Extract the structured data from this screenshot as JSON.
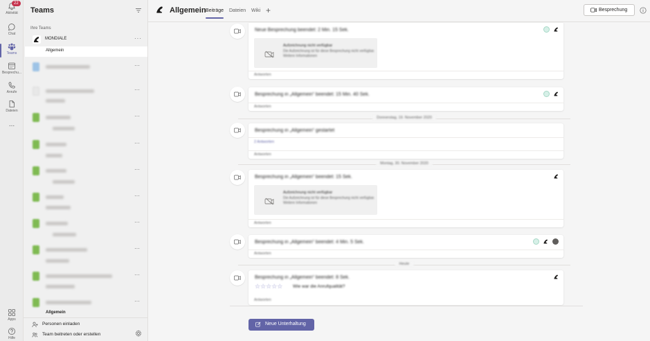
{
  "rail": {
    "activity": {
      "label": "Aktivität",
      "badge": "22"
    },
    "chat": {
      "label": "Chat"
    },
    "teams": {
      "label": "Teams"
    },
    "calendar": {
      "label": "Besprechu..."
    },
    "calls": {
      "label": "Anrufe"
    },
    "files": {
      "label": "Dateien"
    },
    "more": {
      "label": "..."
    },
    "apps": {
      "label": "Apps"
    },
    "help": {
      "label": "Hilfe"
    }
  },
  "panel": {
    "title": "Teams",
    "section_label": "Ihre Teams",
    "team_name": "MONDIALE",
    "channel_name": "Allgemein",
    "more": "···",
    "last_channel": "Allgemein",
    "invite": "Personen einladen",
    "join": "Team beitreten oder erstellen"
  },
  "header": {
    "channel_title": "Allgemein",
    "tabs": [
      "Beiträge",
      "Dateien",
      "Wiki"
    ],
    "add_tab": "+",
    "meet_button": "Besprechung"
  },
  "feed": {
    "posts": [
      {
        "title": "Neue Besprechung beendet: 2 Min. 15 Sek.",
        "reply": "Antworten",
        "card": {
          "l1": "Aufzeichnung nicht verfügbar",
          "l2": "Die Aufzeichnung ist für diese Besprechung nicht verfügbar.",
          "l3": "Weitere Informationen"
        }
      },
      {
        "title": "Besprechung in „Allgemein“ beendet: 15 Min. 40 Sek.",
        "reply": "Antworten"
      },
      {
        "title": "Besprechung in „Allgemein“ gestartet",
        "link": "2 Antworten",
        "reply": "Antworten"
      },
      {
        "title": "Besprechung in „Allgemein“ beendet: 15 Sek.",
        "reply": "Antworten",
        "card": {
          "l1": "Aufzeichnung nicht verfügbar",
          "l2": "Die Aufzeichnung ist für diese Besprechung nicht verfügbar.",
          "l3": "Weitere Informationen"
        }
      },
      {
        "title": "Besprechung in „Allgemein“ beendet: 4 Min. 5 Sek.",
        "reply": "Antworten"
      },
      {
        "title": "Besprechung in „Allgemein“ beendet: 8 Sek.",
        "rating_text": "Wie war die Anrufqualität?",
        "reply": "Antworten"
      }
    ],
    "separators": [
      "Donnerstag, 19. November 2020",
      "Montag, 30. November 2020",
      "Heute"
    ],
    "new_conversation": "Neue Unterhaltung"
  },
  "colors": {
    "brand": "#6264a7",
    "badge": "#c4314b",
    "team_green": "#7fba52"
  }
}
